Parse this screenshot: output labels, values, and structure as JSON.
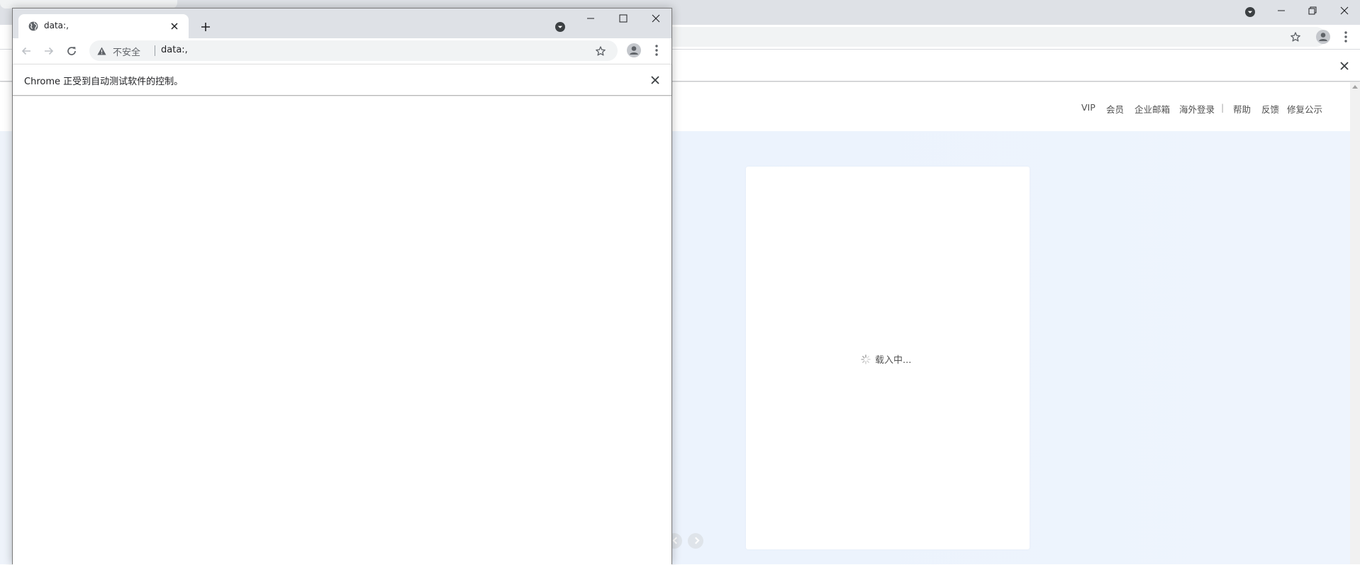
{
  "background_window": {
    "infobar_close_label": "✕",
    "nav": {
      "items": [
        "VIP",
        "会员",
        "企业邮箱",
        "海外登录"
      ],
      "separator": "|",
      "items_after": [
        "帮助",
        "反馈",
        "修复公示"
      ]
    },
    "loading_text": "载入中..."
  },
  "foreground_window": {
    "tab": {
      "title": "data:,",
      "close_label": "✕"
    },
    "new_tab_label": "+",
    "omnibox": {
      "security_label": "不安全",
      "url": "data:,"
    },
    "infobar": {
      "message": "Chrome 正受到自动测试软件的控制。",
      "close_label": "✕"
    }
  },
  "colors": {
    "titlebar": "#dee1e6",
    "omnibox": "#f1f3f4",
    "hero_background": "#ecf3fd",
    "card": "#ffffff",
    "text_primary": "#202124",
    "icon": "#5f6368"
  }
}
